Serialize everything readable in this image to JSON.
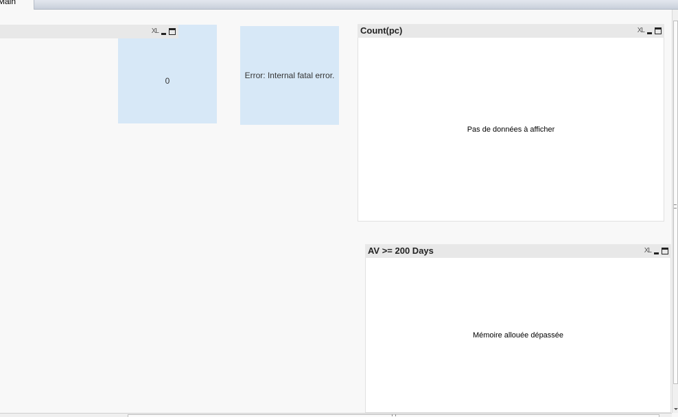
{
  "tabs": [
    {
      "label": "Main",
      "active": true
    }
  ],
  "left_panel": {
    "title": "",
    "xl_label": "XL"
  },
  "text_box_count": {
    "value": "0"
  },
  "text_box_error": {
    "message": "Error: Internal fatal error."
  },
  "chart_count_pc": {
    "title": "Count(pc)",
    "xl_label": "XL",
    "message": "Pas de données à afficher"
  },
  "chart_av_200": {
    "title": "AV >= 200 Days",
    "xl_label": "XL",
    "message": "Mémoire allouée dépassée"
  },
  "colors": {
    "background": "#f8f8f8",
    "caption": "#e8e8e8",
    "text_box": "#d7e8f7",
    "tabbar": "#c9d0db"
  }
}
